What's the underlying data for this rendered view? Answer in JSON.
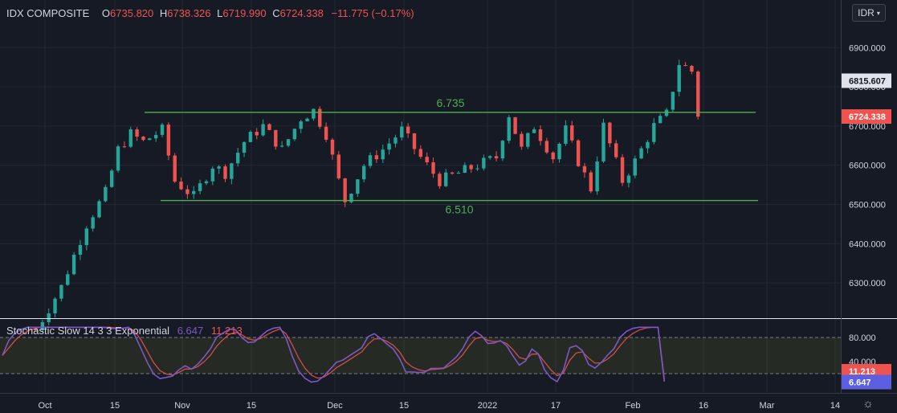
{
  "header": {
    "symbol": "IDX COMPOSITE",
    "open_label": "O",
    "open": "6735.820",
    "high_label": "H",
    "high": "6738.326",
    "low_label": "L",
    "low": "6719.990",
    "close_label": "C",
    "close": "6724.338",
    "change": "−11.775 (−0.17%)"
  },
  "currency_button": {
    "label": "IDR",
    "icon": "chevron-down-icon"
  },
  "settings_icon": "gear-icon",
  "price_scale": {
    "ticks": [
      "6900.000",
      "6800.000",
      "6700.000",
      "6600.000",
      "6500.000",
      "6400.000",
      "6300.000"
    ],
    "marker_current": "6724.338",
    "marker_high": "6815.607"
  },
  "indicator": {
    "name": "Stochastic Slow 14 3 3 Exponential",
    "k_value": "6.647",
    "d_value": "11.213",
    "ticks": [
      "80.000",
      "40.000"
    ],
    "upper_band": 80,
    "lower_band": 20
  },
  "time_axis": [
    "Oct",
    "15",
    "Nov",
    "15",
    "Dec",
    "15",
    "2022",
    "17",
    "Feb",
    "16",
    "Mar",
    "14"
  ],
  "colors": {
    "background": "#161a25",
    "up": "#26a69a",
    "down": "#ef5350",
    "level_line": "#4caf50",
    "k_line": "#7e57c2",
    "d_line": "#ef5350"
  },
  "chart_data": {
    "type": "candlestick",
    "title": "IDX COMPOSITE",
    "ylim": [
      6210,
      6960
    ],
    "price_path": [
      [
        0,
        6180
      ],
      [
        4,
        6290
      ],
      [
        8,
        6450
      ],
      [
        11,
        6530
      ],
      [
        13,
        6640
      ],
      [
        15,
        6680
      ],
      [
        17,
        6660
      ],
      [
        20,
        6690
      ],
      [
        22,
        6560
      ],
      [
        25,
        6520
      ],
      [
        28,
        6600
      ],
      [
        30,
        6580
      ],
      [
        33,
        6660
      ],
      [
        36,
        6700
      ],
      [
        39,
        6640
      ],
      [
        42,
        6720
      ],
      [
        44,
        6740
      ],
      [
        46,
        6680
      ],
      [
        48,
        6560
      ],
      [
        49,
        6510
      ],
      [
        52,
        6600
      ],
      [
        55,
        6640
      ],
      [
        58,
        6690
      ],
      [
        61,
        6620
      ],
      [
        64,
        6560
      ],
      [
        67,
        6580
      ],
      [
        70,
        6600
      ],
      [
        73,
        6620
      ],
      [
        75,
        6730
      ],
      [
        77,
        6640
      ],
      [
        79,
        6700
      ],
      [
        82,
        6620
      ],
      [
        84,
        6690
      ],
      [
        86,
        6610
      ],
      [
        88,
        6540
      ],
      [
        90,
        6700
      ],
      [
        93,
        6560
      ],
      [
        95,
        6610
      ],
      [
        98,
        6700
      ],
      [
        100,
        6730
      ],
      [
        102,
        6860
      ],
      [
        104,
        6840
      ],
      [
        105,
        6724
      ]
    ],
    "levels": [
      {
        "label": "6.735",
        "value": 6735
      },
      {
        "label": "6.510",
        "value": 6510
      }
    ],
    "stochastic": {
      "ylim": [
        0,
        100
      ],
      "bands": [
        20,
        80
      ],
      "k_last": 6.647,
      "d_last": 11.213
    }
  }
}
